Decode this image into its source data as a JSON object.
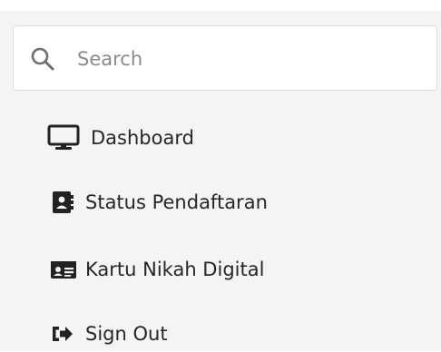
{
  "search": {
    "placeholder": "Search",
    "icon": "search-icon"
  },
  "menu": {
    "items": [
      {
        "label": "Dashboard",
        "icon": "monitor-icon"
      },
      {
        "label": "Status Pendaftaran",
        "icon": "contact-book-icon"
      },
      {
        "label": "Kartu Nikah Digital",
        "icon": "id-card-icon"
      },
      {
        "label": "Sign Out",
        "icon": "sign-out-icon"
      }
    ]
  },
  "colors": {
    "sidebar_bg": "#f4f4f4",
    "text": "#262626",
    "icon": "#222222",
    "placeholder": "#8a8a8a"
  }
}
